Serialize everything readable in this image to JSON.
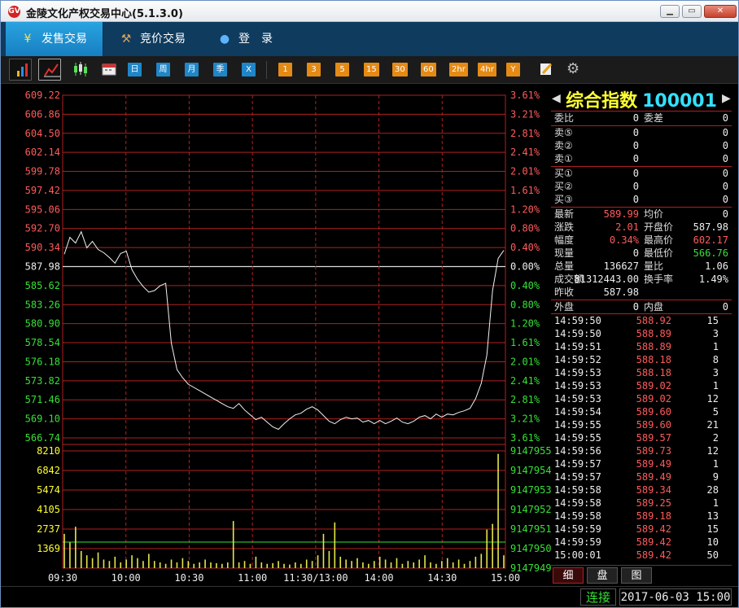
{
  "window": {
    "title": "金陵文化产权交易中心(5.1.3.0)",
    "logo": "GV"
  },
  "nav": [
    {
      "label": "发售交易",
      "icon": "yen-icon"
    },
    {
      "label": "竞价交易",
      "icon": "gavel-icon"
    },
    {
      "label": "登　录",
      "icon": "user-icon"
    }
  ],
  "toolbar": {
    "periods_blue": [
      "日",
      "周",
      "月",
      "季",
      "X"
    ],
    "periods_orange": [
      "1",
      "3",
      "5",
      "15",
      "30",
      "60",
      "2hr",
      "4hr",
      "Y"
    ]
  },
  "chart_data": {
    "type": "line",
    "base": 587.98,
    "price_ticks": [
      "609.22",
      "606.86",
      "604.50",
      "602.14",
      "599.78",
      "597.42",
      "595.06",
      "592.70",
      "590.34",
      "587.98",
      "585.62",
      "583.26",
      "580.90",
      "578.54",
      "576.18",
      "573.82",
      "571.46",
      "569.10",
      "566.74"
    ],
    "pct_ticks": [
      "3.61%",
      "3.21%",
      "2.81%",
      "2.41%",
      "2.01%",
      "1.61%",
      "1.20%",
      "0.80%",
      "0.40%",
      "0.00%",
      "0.40%",
      "0.80%",
      "1.20%",
      "1.61%",
      "2.01%",
      "2.41%",
      "2.81%",
      "3.21%",
      "3.61%"
    ],
    "vol_ticks": [
      "8210",
      "6842",
      "5474",
      "4105",
      "2737",
      "1369"
    ],
    "vol_right_ticks": [
      "9147955",
      "9147954",
      "9147953",
      "9147952",
      "9147951",
      "9147950",
      "9147949"
    ],
    "time_ticks": [
      "09:30",
      "10:00",
      "10:30",
      "11:00",
      "11:30/13:00",
      "14:00",
      "14:30",
      "15:00"
    ],
    "ylim": [
      566.74,
      609.22
    ],
    "vol_max": 8210,
    "price_series": [
      589.5,
      591.6,
      590.9,
      592.3,
      590.3,
      591.1,
      590.1,
      589.7,
      589.1,
      588.4,
      589.6,
      589.9,
      587.6,
      586.4,
      585.5,
      584.8,
      585.0,
      585.6,
      585.9,
      578.5,
      575.2,
      574.2,
      573.4,
      573.0,
      572.6,
      572.2,
      571.8,
      571.4,
      571.0,
      570.6,
      570.4,
      571.0,
      570.2,
      569.6,
      569.0,
      569.3,
      568.7,
      568.1,
      567.8,
      568.5,
      569.1,
      569.6,
      569.8,
      570.3,
      570.6,
      570.2,
      569.5,
      568.8,
      568.5,
      569.0,
      569.3,
      569.1,
      569.2,
      568.7,
      568.9,
      568.5,
      568.9,
      568.5,
      568.8,
      569.2,
      568.7,
      568.5,
      568.8,
      569.3,
      569.5,
      569.1,
      569.7,
      569.3,
      569.7,
      569.6,
      569.9,
      570.1,
      570.4,
      571.6,
      573.5,
      577.0,
      585.0,
      589.0,
      589.99
    ],
    "volume_series": [
      2400,
      1800,
      2900,
      1200,
      900,
      700,
      1100,
      600,
      500,
      800,
      400,
      600,
      900,
      700,
      500,
      1000,
      500,
      400,
      300,
      600,
      400,
      700,
      500,
      300,
      400,
      600,
      400,
      350,
      300,
      400,
      3300,
      400,
      500,
      300,
      800,
      400,
      300,
      350,
      500,
      300,
      250,
      400,
      300,
      600,
      500,
      900,
      2400,
      1200,
      3200,
      800,
      600,
      500,
      700,
      400,
      300,
      500,
      800,
      600,
      400,
      700,
      300,
      500,
      400,
      600,
      900,
      400,
      300,
      500,
      700,
      400,
      600,
      300,
      500,
      800,
      1000,
      2700,
      3100,
      8000,
      900
    ]
  },
  "quote": {
    "name": "综合指数",
    "code": "100001",
    "weibi_label": "委比",
    "weibi": "0",
    "weicha_label": "委差",
    "weicha": "0",
    "sell": [
      {
        "label": "卖⑤",
        "price": "0",
        "vol": "0"
      },
      {
        "label": "卖②",
        "price": "0",
        "vol": "0"
      },
      {
        "label": "卖①",
        "price": "0",
        "vol": "0"
      }
    ],
    "buy": [
      {
        "label": "买①",
        "price": "0",
        "vol": "0"
      },
      {
        "label": "买②",
        "price": "0",
        "vol": "0"
      },
      {
        "label": "买③",
        "price": "0",
        "vol": "0"
      }
    ],
    "stats": [
      {
        "l1": "最新",
        "v1": "589.99",
        "c1": "red",
        "l2": "均价",
        "v2": "0",
        "c2": "white"
      },
      {
        "l1": "涨跌",
        "v1": "2.01",
        "c1": "red",
        "l2": "开盘价",
        "v2": "587.98",
        "c2": "white"
      },
      {
        "l1": "幅度",
        "v1": "0.34%",
        "c1": "red",
        "l2": "最高价",
        "v2": "602.17",
        "c2": "red"
      },
      {
        "l1": "现量",
        "v1": "0",
        "c1": "white",
        "l2": "最低价",
        "v2": "566.76",
        "c2": "green"
      },
      {
        "l1": "总量",
        "v1": "136627",
        "c1": "white",
        "l2": "量比",
        "v2": "1.06",
        "c2": "white"
      },
      {
        "l1": "成交额",
        "v1": "81312443.00",
        "c1": "white",
        "l2": "换手率",
        "v2": "1.49%",
        "c2": "white"
      },
      {
        "l1": "昨收",
        "v1": "587.98",
        "c1": "white",
        "l2": "",
        "v2": "",
        "c2": "white"
      }
    ],
    "waipan_label": "外盘",
    "waipan": "0",
    "neipan_label": "内盘",
    "neipan": "0"
  },
  "ticks": [
    [
      "14:59:50",
      "588.92",
      "15"
    ],
    [
      "14:59:50",
      "588.89",
      "3"
    ],
    [
      "14:59:51",
      "588.89",
      "1"
    ],
    [
      "14:59:52",
      "588.18",
      "8"
    ],
    [
      "14:59:53",
      "588.18",
      "3"
    ],
    [
      "14:59:53",
      "589.02",
      "1"
    ],
    [
      "14:59:53",
      "589.02",
      "12"
    ],
    [
      "14:59:54",
      "589.60",
      "5"
    ],
    [
      "14:59:55",
      "589.60",
      "21"
    ],
    [
      "14:59:55",
      "589.57",
      "2"
    ],
    [
      "14:59:56",
      "589.73",
      "12"
    ],
    [
      "14:59:57",
      "589.49",
      "1"
    ],
    [
      "14:59:57",
      "589.49",
      "9"
    ],
    [
      "14:59:58",
      "589.34",
      "28"
    ],
    [
      "14:59:58",
      "589.25",
      "1"
    ],
    [
      "14:59:58",
      "589.18",
      "13"
    ],
    [
      "14:59:59",
      "589.42",
      "15"
    ],
    [
      "14:59:59",
      "589.42",
      "10"
    ],
    [
      "15:00:01",
      "589.42",
      "50"
    ]
  ],
  "tabs": [
    "细",
    "盘",
    "图"
  ],
  "status": {
    "connection": "连接",
    "datetime": "2017-06-03 15:00"
  }
}
